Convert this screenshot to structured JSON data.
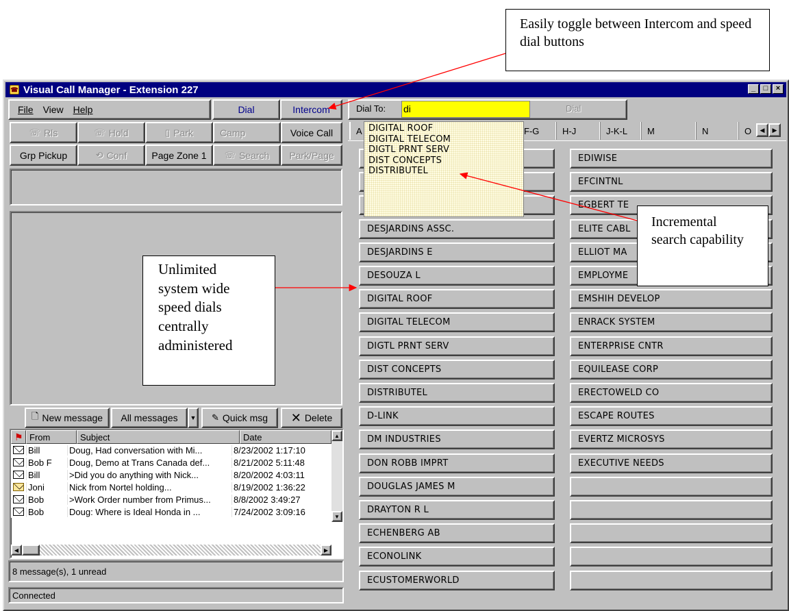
{
  "annotations": {
    "toggle": "Easily toggle between Intercom and speed dial buttons",
    "incremental": "Incremental search capability",
    "unlimited": "Unlimited system wide speed dials centrally administered"
  },
  "window": {
    "title": "Visual Call Manager - Extension 227"
  },
  "menu": {
    "file": "File",
    "view": "View",
    "help": "Help"
  },
  "top_buttons": {
    "dial": "Dial",
    "intercom": "Intercom"
  },
  "call_buttons": {
    "rls": "Rls",
    "hold": "Hold",
    "park": "Park",
    "camp": "Camp",
    "voice_call": "Voice Call",
    "grp_pickup": "Grp Pickup",
    "conf": "Conf",
    "page_zone": "Page Zone 1",
    "search": "Search",
    "park_page": "Park/Page"
  },
  "dial_to": {
    "label": "Dial To:",
    "value": "di",
    "dial_button": "Dial"
  },
  "tabs": [
    "A",
    "F-G",
    "H-J",
    "J-K-L",
    "M",
    "N",
    "O"
  ],
  "autocomplete": [
    "DIGITAL ROOF",
    "DIGITAL TELECOM",
    "DIGTL PRNT SERV",
    "DIST CONCEPTS",
    "DISTRIBUTEL"
  ],
  "speed_dial_col1": [
    "",
    "",
    "",
    "DESJARDINS ASSC.",
    "DESJARDINS E",
    "DESOUZA L",
    "DIGITAL ROOF",
    "DIGITAL TELECOM",
    "DIGTL PRNT SERV",
    "DIST CONCEPTS",
    "DISTRIBUTEL",
    "D-LINK",
    "DM INDUSTRIES",
    "DON ROBB IMPRT",
    "DOUGLAS JAMES M",
    "DRAYTON R L",
    "ECHENBERG AB",
    "ECONOLINK",
    "ECUSTOMERWORLD"
  ],
  "speed_dial_col2": [
    "EDIWISE",
    "EFCINTNL",
    "EGBERT TE",
    "ELITE CABL",
    "ELLIOT MA",
    "EMPLOYME",
    "EMSHIH DEVELOP",
    "ENRACK SYSTEM",
    "ENTERPRISE CNTR",
    "EQUILEASE CORP",
    "ERECTOWELD CO",
    "ESCAPE ROUTES",
    "EVERTZ MICROSYS",
    "EXECUTIVE NEEDS",
    "",
    "",
    "",
    "",
    ""
  ],
  "toolbar": {
    "new_message": "New message",
    "all_messages": "All messages",
    "quick_msg": "Quick msg",
    "delete": "Delete"
  },
  "messages_header": {
    "from": "From",
    "subject": "Subject",
    "date": "Date"
  },
  "messages": [
    {
      "from": "Bill",
      "subject": "Doug, Had conversation with Mi...",
      "date": "8/23/2002 1:17:10"
    },
    {
      "from": "Bob F",
      "subject": "Doug, Demo at Trans Canada def...",
      "date": "8/21/2002 5:11:48"
    },
    {
      "from": "Bill",
      "subject": ">Did you do anything with Nick...",
      "date": "8/20/2002 4:03:11"
    },
    {
      "from": "Joni",
      "subject": "Nick from Nortel holding...",
      "date": "8/19/2002 1:36:22"
    },
    {
      "from": "Bob",
      "subject": ">Work Order number from Primus...",
      "date": "8/8/2002 3:49:27"
    },
    {
      "from": "Bob",
      "subject": "Doug: Where is Ideal Honda in ...",
      "date": "7/24/2002 3:09:16"
    }
  ],
  "status": {
    "count": "8 message(s), 1 unread",
    "connection": "Connected"
  },
  "colors": {
    "titlebar": "#000080",
    "face": "#c0c0c0",
    "dial_input": "#ffff00",
    "autocomplete_bg": "#fffde0",
    "arrow": "#ff0000"
  }
}
